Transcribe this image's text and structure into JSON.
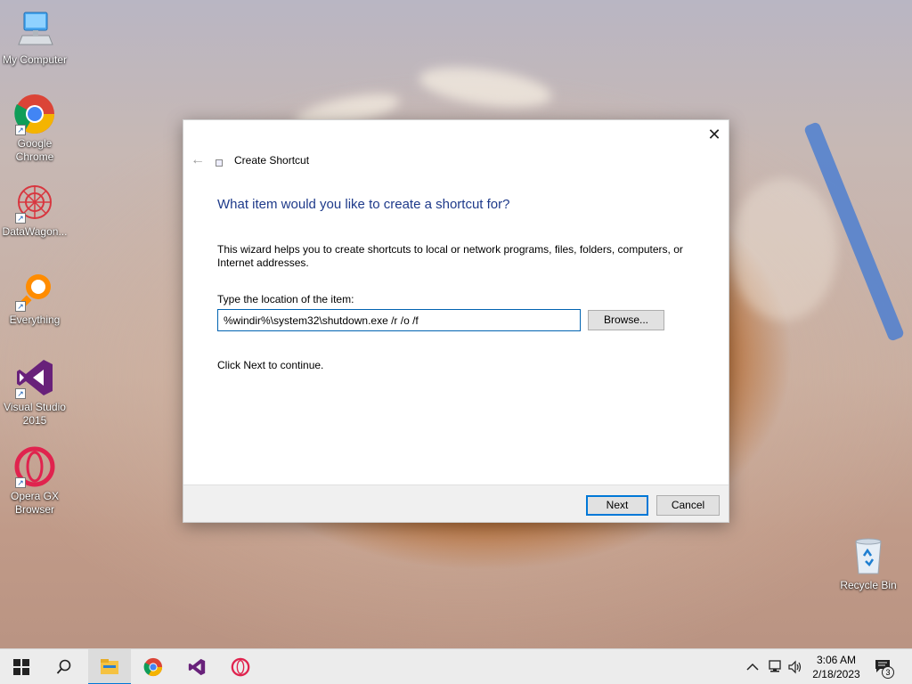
{
  "desktop": {
    "icons": [
      {
        "label": "My Computer",
        "icon": "computer-icon"
      },
      {
        "label": "Google Chrome",
        "icon": "chrome-icon"
      },
      {
        "label": "DataWagon...",
        "icon": "datawagon-icon"
      },
      {
        "label": "Everything",
        "icon": "everything-search-icon"
      },
      {
        "label": "Visual Studio 2015",
        "icon": "visual-studio-icon"
      },
      {
        "label": "Opera GX Browser",
        "icon": "opera-gx-icon"
      }
    ],
    "recycle_bin": {
      "label": "Recycle Bin",
      "icon": "recycle-bin-icon"
    }
  },
  "dialog": {
    "title": "Create Shortcut",
    "heading": "What item would you like to create a shortcut for?",
    "description": "This wizard helps you to create shortcuts to local or network programs, files, folders, computers, or Internet addresses.",
    "location_label": "Type the location of the item:",
    "location_value": "%windir%\\system32\\shutdown.exe /r /o /f",
    "browse_label": "Browse...",
    "continue_text": "Click Next to continue.",
    "next_label": "Next",
    "cancel_label": "Cancel",
    "accent_color": "#1e3a8a",
    "focus_color": "#0078d7"
  },
  "taskbar": {
    "pinned": [
      "start-icon",
      "search-icon",
      "file-explorer-icon",
      "chrome-icon",
      "visual-studio-icon",
      "opera-icon"
    ],
    "tray_icons": [
      "chevron-up-icon",
      "network-icon",
      "volume-icon"
    ],
    "time": "3:06 AM",
    "date": "2/18/2023",
    "notification_count": "3"
  }
}
